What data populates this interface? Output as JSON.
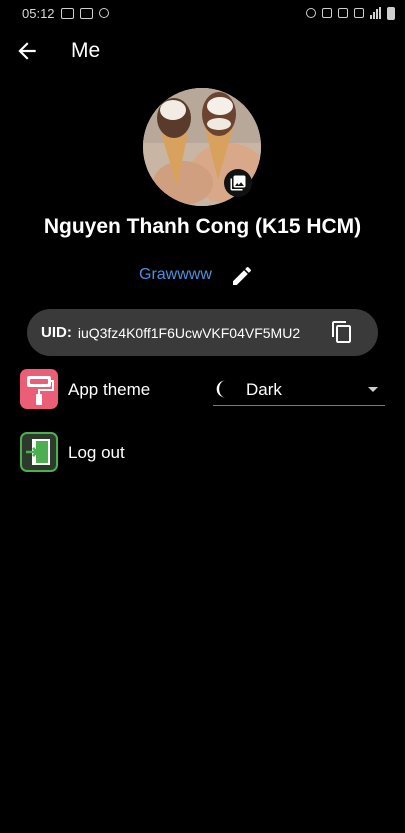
{
  "status_bar": {
    "time": "05:12"
  },
  "app_bar": {
    "title": "Me",
    "back_icon": "arrow-back-icon"
  },
  "profile": {
    "name": "Nguyen Thanh Cong (K15 HCM)",
    "nickname": "Grawwww",
    "uid_label": "UID:",
    "uid_value": "iuQ3fz4K0ff1F6UcwVKF04VF5MU2"
  },
  "settings": {
    "theme_label": "App theme",
    "theme_value": "Dark",
    "logout_label": "Log out"
  },
  "colors": {
    "background": "#000000",
    "accent": "#4a90e2",
    "uid_box": "#3a3a3a",
    "theme_icon": "#ec5d76",
    "logout_icon": "#4caf50"
  }
}
